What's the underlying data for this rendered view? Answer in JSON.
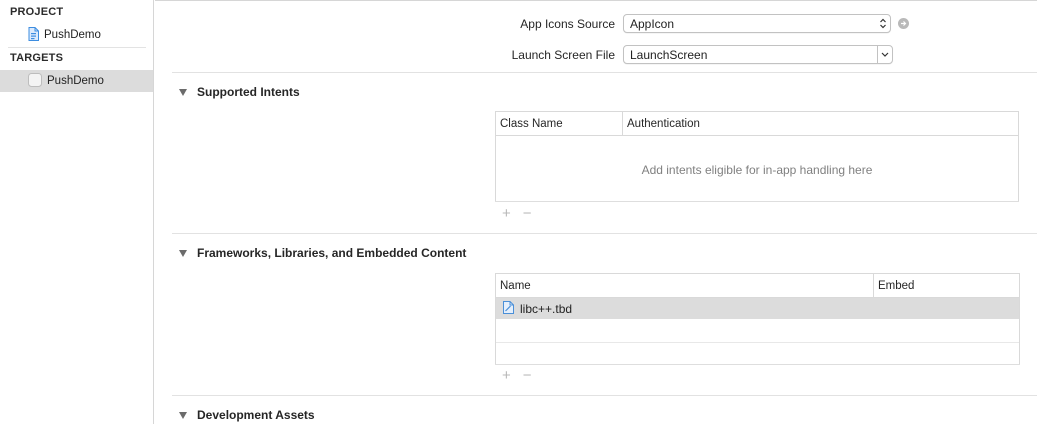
{
  "sidebar": {
    "project_header": "PROJECT",
    "project_item": "PushDemo",
    "targets_header": "TARGETS",
    "target_item": "PushDemo"
  },
  "app_icons": {
    "label": "App Icons Source",
    "value": "AppIcon"
  },
  "launch_screen": {
    "label": "Launch Screen File",
    "value": "LaunchScreen"
  },
  "supported_intents": {
    "title": "Supported Intents",
    "columns": [
      "Class Name",
      "Authentication"
    ],
    "placeholder": "Add intents eligible for in-app handling here",
    "add": "+",
    "remove": "−"
  },
  "frameworks": {
    "title": "Frameworks, Libraries, and Embedded Content",
    "columns": [
      "Name",
      "Embed"
    ],
    "rows": [
      {
        "name": "libc++.tbd",
        "embed": ""
      }
    ],
    "add": "+",
    "remove": "−"
  },
  "development_assets": {
    "title": "Development Assets"
  }
}
